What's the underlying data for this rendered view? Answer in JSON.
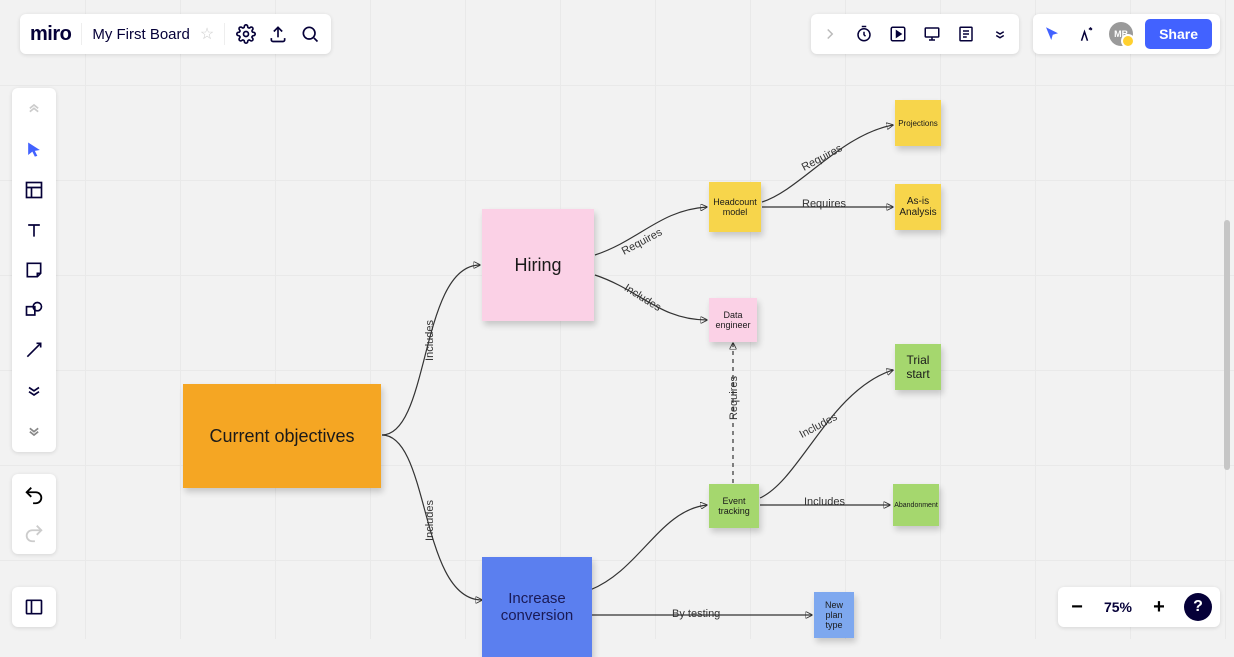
{
  "app": {
    "logo": "miro",
    "board_title": "My First Board",
    "avatar_initials": "MB"
  },
  "buttons": {
    "share": "Share"
  },
  "zoom": {
    "level": "75%"
  },
  "nodes": {
    "objectives": "Current objectives",
    "hiring": "Hiring",
    "increase": "Increase conversion",
    "headcount": "Headcount model",
    "data_eng": "Data engineer",
    "projections": "Projections",
    "asis": "As-is Analysis",
    "event": "Event tracking",
    "trial": "Trial start",
    "abandon": "Abandonment",
    "newplan": "New plan type"
  },
  "edges": {
    "includes": "Includes",
    "requires": "Requires",
    "bytesting": "By testing"
  }
}
